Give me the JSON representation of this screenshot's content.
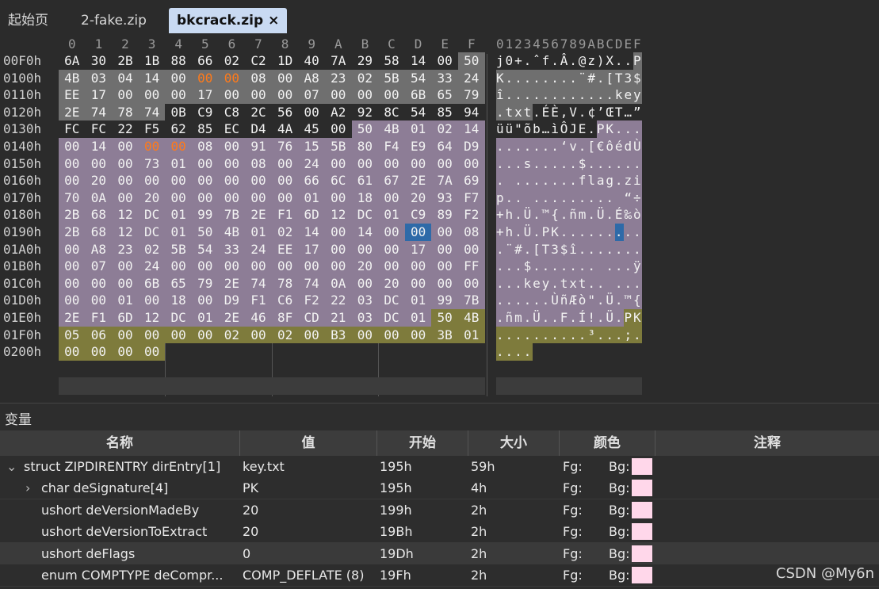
{
  "tabs": [
    {
      "label": "起始页"
    },
    {
      "label": "2-fake.zip"
    },
    {
      "label": "bkcrack.zip",
      "close": "×"
    }
  ],
  "colors": {
    "plain": "#2b2b2b",
    "gray": "#6f6f6f",
    "purple": "#8d7d96",
    "olive": "#7e7b3c",
    "selection": "#2e6aa8",
    "changed": "#ff7a1a"
  },
  "hex": {
    "column_headers": [
      "0",
      "1",
      "2",
      "3",
      "4",
      "5",
      "6",
      "7",
      "8",
      "9",
      "A",
      "B",
      "C",
      "D",
      "E",
      "F"
    ],
    "ascii_header": "0123456789ABCDEF",
    "rows": [
      {
        "offset": "00F0h",
        "bytes": [
          "6A",
          "30",
          "2B",
          "1B",
          "88",
          "66",
          "02",
          "C2",
          "1D",
          "40",
          "7A",
          "29",
          "58",
          "14",
          "00",
          "50"
        ],
        "ascii": "j0+.ˆf.Â.@z)X..P",
        "bg": "pppppppppppppppg"
      },
      {
        "offset": "0100h",
        "bytes": [
          "4B",
          "03",
          "04",
          "14",
          "00",
          "00",
          "00",
          "08",
          "00",
          "A8",
          "23",
          "02",
          "5B",
          "54",
          "33",
          "24"
        ],
        "ascii": "K........¨#.[T3$",
        "bg": "gggggggggggggggg",
        "changed": [
          5,
          6
        ]
      },
      {
        "offset": "0110h",
        "bytes": [
          "EE",
          "17",
          "00",
          "00",
          "00",
          "17",
          "00",
          "00",
          "00",
          "07",
          "00",
          "00",
          "00",
          "6B",
          "65",
          "79"
        ],
        "ascii": "î............key",
        "bg": "gggggggggggggggg"
      },
      {
        "offset": "0120h",
        "bytes": [
          "2E",
          "74",
          "78",
          "74",
          "0B",
          "C9",
          "C8",
          "2C",
          "56",
          "00",
          "A2",
          "92",
          "8C",
          "54",
          "85",
          "94"
        ],
        "ascii": ".txt.ÉÈ,V.¢’ŒT…”",
        "bg": "ggggpppppppppppp"
      },
      {
        "offset": "0130h",
        "bytes": [
          "FC",
          "FC",
          "22",
          "F5",
          "62",
          "85",
          "EC",
          "D4",
          "4A",
          "45",
          "00",
          "50",
          "4B",
          "01",
          "02",
          "14"
        ],
        "ascii": "üü\"õb…ìÔJE.PK...",
        "bg": "pppppppppppuuuuu"
      },
      {
        "offset": "0140h",
        "bytes": [
          "00",
          "14",
          "00",
          "00",
          "00",
          "08",
          "00",
          "91",
          "76",
          "15",
          "5B",
          "80",
          "F4",
          "E9",
          "64",
          "D9"
        ],
        "ascii": ".......‘v.[€ôédÙ",
        "bg": "uuuuuuuuuuuuuuuu",
        "changed": [
          3,
          4
        ]
      },
      {
        "offset": "0150h",
        "bytes": [
          "00",
          "00",
          "00",
          "73",
          "01",
          "00",
          "00",
          "08",
          "00",
          "24",
          "00",
          "00",
          "00",
          "00",
          "00",
          "00"
        ],
        "ascii": "...s.....$......",
        "bg": "uuuuuuuuuuuuuuuu"
      },
      {
        "offset": "0160h",
        "bytes": [
          "00",
          "20",
          "00",
          "00",
          "00",
          "00",
          "00",
          "00",
          "00",
          "66",
          "6C",
          "61",
          "67",
          "2E",
          "7A",
          "69"
        ],
        "ascii": ". .......flag.zi",
        "bg": "uuuuuuuuuuuuuuuu"
      },
      {
        "offset": "0170h",
        "bytes": [
          "70",
          "0A",
          "00",
          "20",
          "00",
          "00",
          "00",
          "00",
          "00",
          "01",
          "00",
          "18",
          "00",
          "20",
          "93",
          "F7"
        ],
        "ascii": "p.. ......... “÷",
        "bg": "uuuuuuuuuuuuuuuu"
      },
      {
        "offset": "0180h",
        "bytes": [
          "2B",
          "68",
          "12",
          "DC",
          "01",
          "99",
          "7B",
          "2E",
          "F1",
          "6D",
          "12",
          "DC",
          "01",
          "C9",
          "89",
          "F2"
        ],
        "ascii": "+h.Ü.™{.ñm.Ü.É‰ò",
        "bg": "uuuuuuuuuuuuuuuu"
      },
      {
        "offset": "0190h",
        "bytes": [
          "2B",
          "68",
          "12",
          "DC",
          "01",
          "50",
          "4B",
          "01",
          "02",
          "14",
          "00",
          "14",
          "00",
          "00",
          "00",
          "08"
        ],
        "ascii": "+h.Ü.PK.........",
        "bg": "uuuuuuuuuuuuusuu",
        "sel": [
          13,
          14
        ]
      },
      {
        "offset": "01A0h",
        "bytes": [
          "00",
          "A8",
          "23",
          "02",
          "5B",
          "54",
          "33",
          "24",
          "EE",
          "17",
          "00",
          "00",
          "00",
          "17",
          "00",
          "00"
        ],
        "ascii": ".¨#.[T3$î.......",
        "bg": "uuuuuuuuuuuuuuuu"
      },
      {
        "offset": "01B0h",
        "bytes": [
          "00",
          "07",
          "00",
          "24",
          "00",
          "00",
          "00",
          "00",
          "00",
          "00",
          "00",
          "20",
          "00",
          "00",
          "00",
          "FF"
        ],
        "ascii": "...$....... ...ÿ",
        "bg": "uuuuuuuuuuuuuuuu"
      },
      {
        "offset": "01C0h",
        "bytes": [
          "00",
          "00",
          "00",
          "6B",
          "65",
          "79",
          "2E",
          "74",
          "78",
          "74",
          "0A",
          "00",
          "20",
          "00",
          "00",
          "00"
        ],
        "ascii": "...key.txt.. ...",
        "bg": "uuuuuuuuuuuuuuuu"
      },
      {
        "offset": "01D0h",
        "bytes": [
          "00",
          "00",
          "01",
          "00",
          "18",
          "00",
          "D9",
          "F1",
          "C6",
          "F2",
          "22",
          "03",
          "DC",
          "01",
          "99",
          "7B"
        ],
        "ascii": "......ÙñÆò\".Ü.™{",
        "bg": "uuuuuuuuuuuuuuuu"
      },
      {
        "offset": "01E0h",
        "bytes": [
          "2E",
          "F1",
          "6D",
          "12",
          "DC",
          "01",
          "2E",
          "46",
          "8F",
          "CD",
          "21",
          "03",
          "DC",
          "01",
          "50",
          "4B"
        ],
        "ascii": ".ñm.Ü..F.Í!.Ü.PK",
        "bg": "uuuuuuuuuuuuuuoo"
      },
      {
        "offset": "01F0h",
        "bytes": [
          "05",
          "06",
          "00",
          "00",
          "00",
          "00",
          "02",
          "00",
          "02",
          "00",
          "B3",
          "00",
          "00",
          "00",
          "3B",
          "01"
        ],
        "ascii": "..........³...;.",
        "bg": "oooooooooooooooo"
      },
      {
        "offset": "0200h",
        "bytes": [
          "00",
          "00",
          "00",
          "00"
        ],
        "ascii": "....",
        "bg": "oooo"
      }
    ]
  },
  "variables": {
    "title": "变量",
    "columns": [
      "名称",
      "值",
      "开始",
      "大小",
      "颜色",
      "注释"
    ],
    "rows": [
      {
        "expander": "⌄",
        "name": "struct ZIPDIRENTRY dirEntry[1]",
        "value": "key.txt",
        "start": "195h",
        "size": "59h",
        "fg": "Fg:",
        "bg": "Bg:",
        "indent": 0
      },
      {
        "expander": "›",
        "name": "char deSignature[4]",
        "value": "PK",
        "start": "195h",
        "size": "4h",
        "fg": "Fg:",
        "bg": "Bg:",
        "indent": 1
      },
      {
        "expander": "",
        "name": "ushort deVersionMadeBy",
        "value": "20",
        "start": "199h",
        "size": "2h",
        "fg": "Fg:",
        "bg": "Bg:",
        "indent": 1
      },
      {
        "expander": "",
        "name": "ushort deVersionToExtract",
        "value": "20",
        "start": "19Bh",
        "size": "2h",
        "fg": "Fg:",
        "bg": "Bg:",
        "indent": 1
      },
      {
        "expander": "",
        "name": "ushort deFlags",
        "value": "0",
        "start": "19Dh",
        "size": "2h",
        "fg": "Fg:",
        "bg": "Bg:",
        "indent": 1
      },
      {
        "expander": "",
        "name": "enum COMPTYPE deCompr...",
        "value": "COMP_DEFLATE (8)",
        "start": "19Fh",
        "size": "2h",
        "fg": "Fg:",
        "bg": "Bg:",
        "indent": 1
      }
    ]
  },
  "watermark": "CSDN @My6n"
}
